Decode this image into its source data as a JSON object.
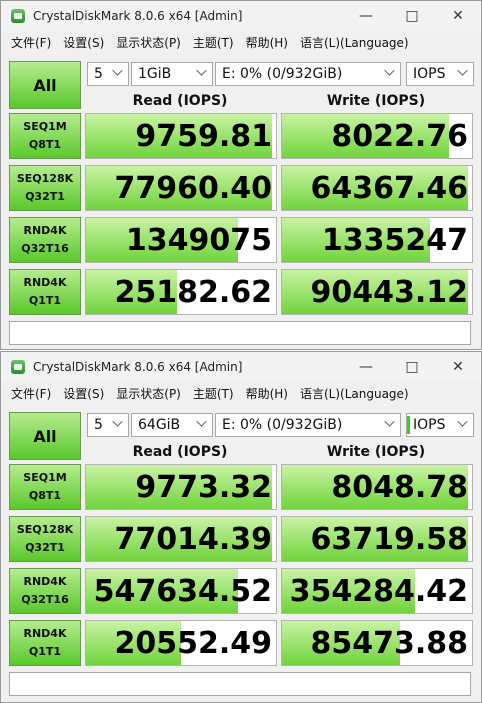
{
  "windows": [
    {
      "title": "CrystalDiskMark 8.0.6 x64 [Admin]",
      "menu": [
        "文件(F)",
        "设置(S)",
        "显示状态(P)",
        "主题(T)",
        "帮助(H)",
        "语言(L)(Language)"
      ],
      "all_label": "All",
      "count": "5",
      "size": "1GiB",
      "drive": "E: 0% (0/932GiB)",
      "unit": "IOPS",
      "read_header": "Read (IOPS)",
      "write_header": "Write (IOPS)",
      "rows": [
        {
          "l1": "SEQ1M",
          "l2": "Q8T1",
          "read": "9759.81",
          "write": "8022.76",
          "read_fill": 0.98,
          "write_fill": 0.88
        },
        {
          "l1": "SEQ128K",
          "l2": "Q32T1",
          "read": "77960.40",
          "write": "64367.46",
          "read_fill": 0.98,
          "write_fill": 0.98
        },
        {
          "l1": "RND4K",
          "l2": "Q32T16",
          "read": "1349075",
          "write": "1335247",
          "read_fill": 0.8,
          "write_fill": 0.78
        },
        {
          "l1": "RND4K",
          "l2": "Q1T1",
          "read": "25182.62",
          "write": "90443.12",
          "read_fill": 0.48,
          "write_fill": 0.98
        }
      ]
    },
    {
      "title": "CrystalDiskMark 8.0.6 x64 [Admin]",
      "menu": [
        "文件(F)",
        "设置(S)",
        "显示状态(P)",
        "主题(T)",
        "帮助(H)",
        "语言(L)(Language)"
      ],
      "all_label": "All",
      "count": "5",
      "size": "64GiB",
      "drive": "E: 0% (0/932GiB)",
      "unit": "IOPS",
      "read_header": "Read (IOPS)",
      "write_header": "Write (IOPS)",
      "rows": [
        {
          "l1": "SEQ1M",
          "l2": "Q8T1",
          "read": "9773.32",
          "write": "8048.78",
          "read_fill": 0.98,
          "write_fill": 0.98
        },
        {
          "l1": "SEQ128K",
          "l2": "Q32T1",
          "read": "77014.39",
          "write": "63719.58",
          "read_fill": 0.98,
          "write_fill": 0.98
        },
        {
          "l1": "RND4K",
          "l2": "Q32T16",
          "read": "547634.52",
          "write": "354284.42",
          "read_fill": 0.8,
          "write_fill": 0.7
        },
        {
          "l1": "RND4K",
          "l2": "Q1T1",
          "read": "20552.49",
          "write": "85473.88",
          "read_fill": 0.5,
          "write_fill": 0.62
        }
      ]
    }
  ]
}
